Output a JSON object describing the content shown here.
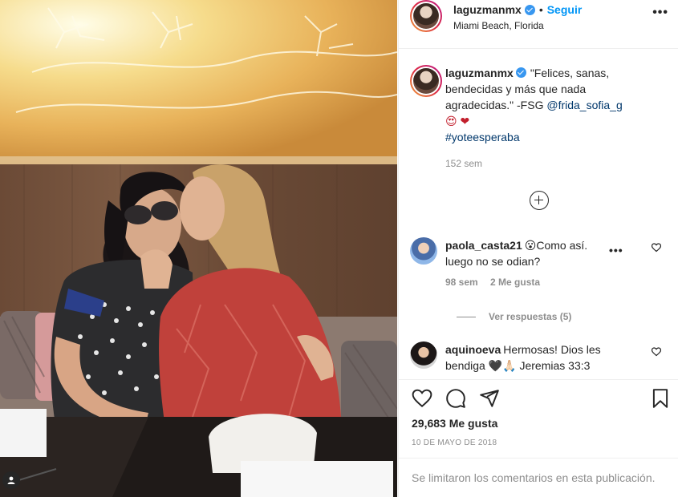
{
  "post": {
    "username": "laguzmanmx",
    "follow_label": "Seguir",
    "separator": "•",
    "location": "Miami Beach, Florida",
    "more_label": "•••"
  },
  "caption": {
    "username": "laguzmanmx",
    "text": "\"Felices, sanas, bendecidas y más que nada agradecidas.\" -FSG ",
    "mention": "@frida_sofia_g",
    "emoji": "😍 ❤",
    "hashtag": "#yoteesperaba",
    "time": "152 sem"
  },
  "comments": [
    {
      "username": "paola_casta21",
      "text": "😮Como así. luego no se odian?",
      "time": "98 sem",
      "likes": "2 Me gusta",
      "replies_label": "Ver respuestas (5)"
    },
    {
      "username": "aquinoeva",
      "text": "Hermosas! Dios les bendiga 🖤🙏🏻 Jeremias 33:3"
    }
  ],
  "footer": {
    "likes": "29,683 Me gusta",
    "date": "10 DE MAYO DE 2018",
    "comments_limited": "Se limitaron los comentarios en esta publicación."
  },
  "icons": {
    "verified": "verified-badge-icon",
    "like": "heart-icon",
    "comment": "comment-icon",
    "share": "share-icon",
    "save": "bookmark-icon",
    "load_more": "plus-circle-icon",
    "user_tag": "user-tag-icon"
  },
  "colors": {
    "accent": "#0095f6",
    "verified": "#3897f0",
    "muted": "#8e8e8e",
    "text": "#262626"
  }
}
